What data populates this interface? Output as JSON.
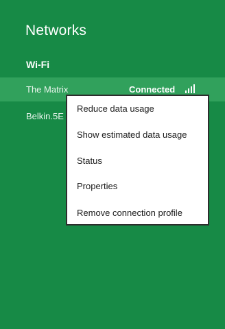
{
  "panel": {
    "title": "Networks"
  },
  "wifi_section": {
    "label": "Wi-Fi"
  },
  "networks": [
    {
      "name": "The Matrix",
      "status": "Connected",
      "signal_icon": "wifi-signal-icon"
    },
    {
      "name": "Belkin.5E"
    }
  ],
  "context_menu": {
    "items": [
      {
        "label": "Reduce data usage"
      },
      {
        "label": "Show estimated data usage"
      },
      {
        "label": "Status"
      },
      {
        "label": "Properties"
      },
      {
        "label": "Remove connection profile"
      }
    ]
  },
  "colors": {
    "background": "#178a46",
    "selected_row": "#31a15c",
    "menu_background": "#ffffff",
    "menu_border": "#2d2d2d"
  }
}
